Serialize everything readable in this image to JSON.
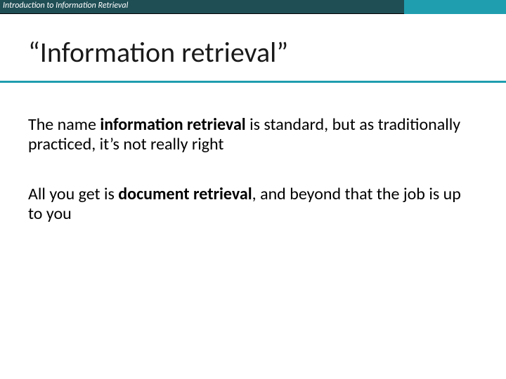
{
  "header": {
    "label": "Introduction to Information Retrieval"
  },
  "title": "“Information retrieval”",
  "p1": {
    "t1": "The name ",
    "b1": "information retrieval",
    "t2": " is standard, but as traditionally practiced, it’s not really right"
  },
  "p2": {
    "t1": "All you get is ",
    "b1": "document retrieval",
    "t2": ", and beyond that the job is up to you"
  }
}
